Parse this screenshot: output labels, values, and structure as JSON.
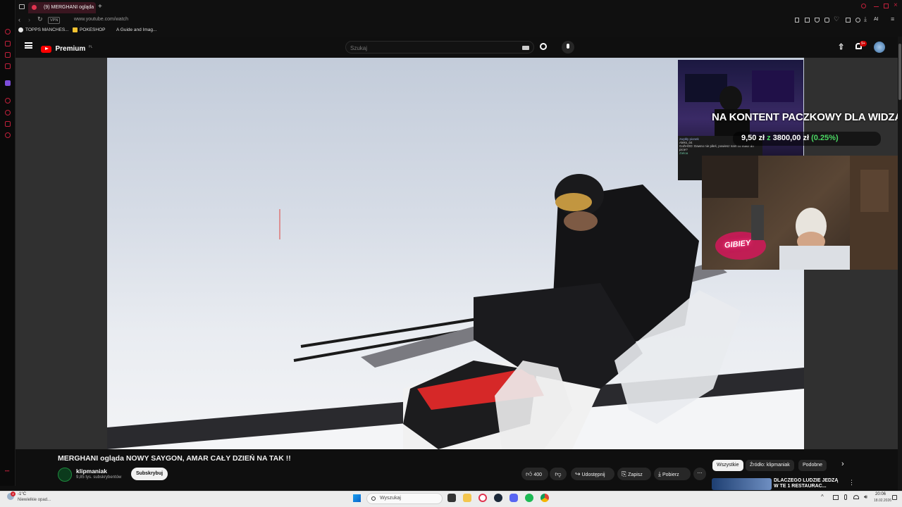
{
  "browser": {
    "tab_title": "(9) MERGHANI ogląda",
    "url": "www.youtube.com/watch",
    "vpn_badge": "VPN",
    "bookmarks": [
      "TOPPS MANCHES...",
      "POKESHOP",
      "A Guide and Imag..."
    ],
    "profile_label": "AI"
  },
  "youtube": {
    "logo_label": "Premium",
    "logo_region": "PL",
    "search_placeholder": "Szukaj",
    "notification_count": "9+"
  },
  "stream_overlay": {
    "donation_title": "NA KONTENT PACZKOWY DLA WIDZA",
    "donation_amount": "9,50 zł",
    "donation_separator": "z",
    "donation_goal": "3800,00 zł",
    "donation_percent": "(0.25%)",
    "chat_lines": [
      "zwykły pionek",
      "Aleks_04",
      "GoñHOD: Dawno nie piłeś, powiesz nam co masz do",
      "picie?",
      "Zieloa"
    ],
    "neon_sign": "GIBIEY"
  },
  "video": {
    "title": "MERGHANI ogląda NOWY SAYGON, AMAR CAŁY DZIEŃ NA TAK !!",
    "channel_name": "klipmaniak",
    "subscribers": "9,85 tys. subskrybentów",
    "subscribe_label": "Subskrybuj",
    "like_count": "400",
    "share_label": "Udostępnij",
    "save_label": "Zapisz",
    "download_label": "Pobierz"
  },
  "chips": [
    "Wszystkie",
    "Źródło: klipmaniak",
    "Podobne"
  ],
  "recommendation": {
    "title": "DLACZEGO LUDZIE JEDZĄ W TE 1 RESTAURAC..."
  },
  "taskbar": {
    "weather_temp": "-1°C",
    "weather_desc": "Niewielkie opad...",
    "search_label": "Wyszukaj",
    "time": "20:06",
    "date": "18.02.2026",
    "weather_badge": "2"
  },
  "colors": {
    "accent": "#e0334f",
    "youtube_red": "#ff0000",
    "percent_green": "#4cd964"
  }
}
